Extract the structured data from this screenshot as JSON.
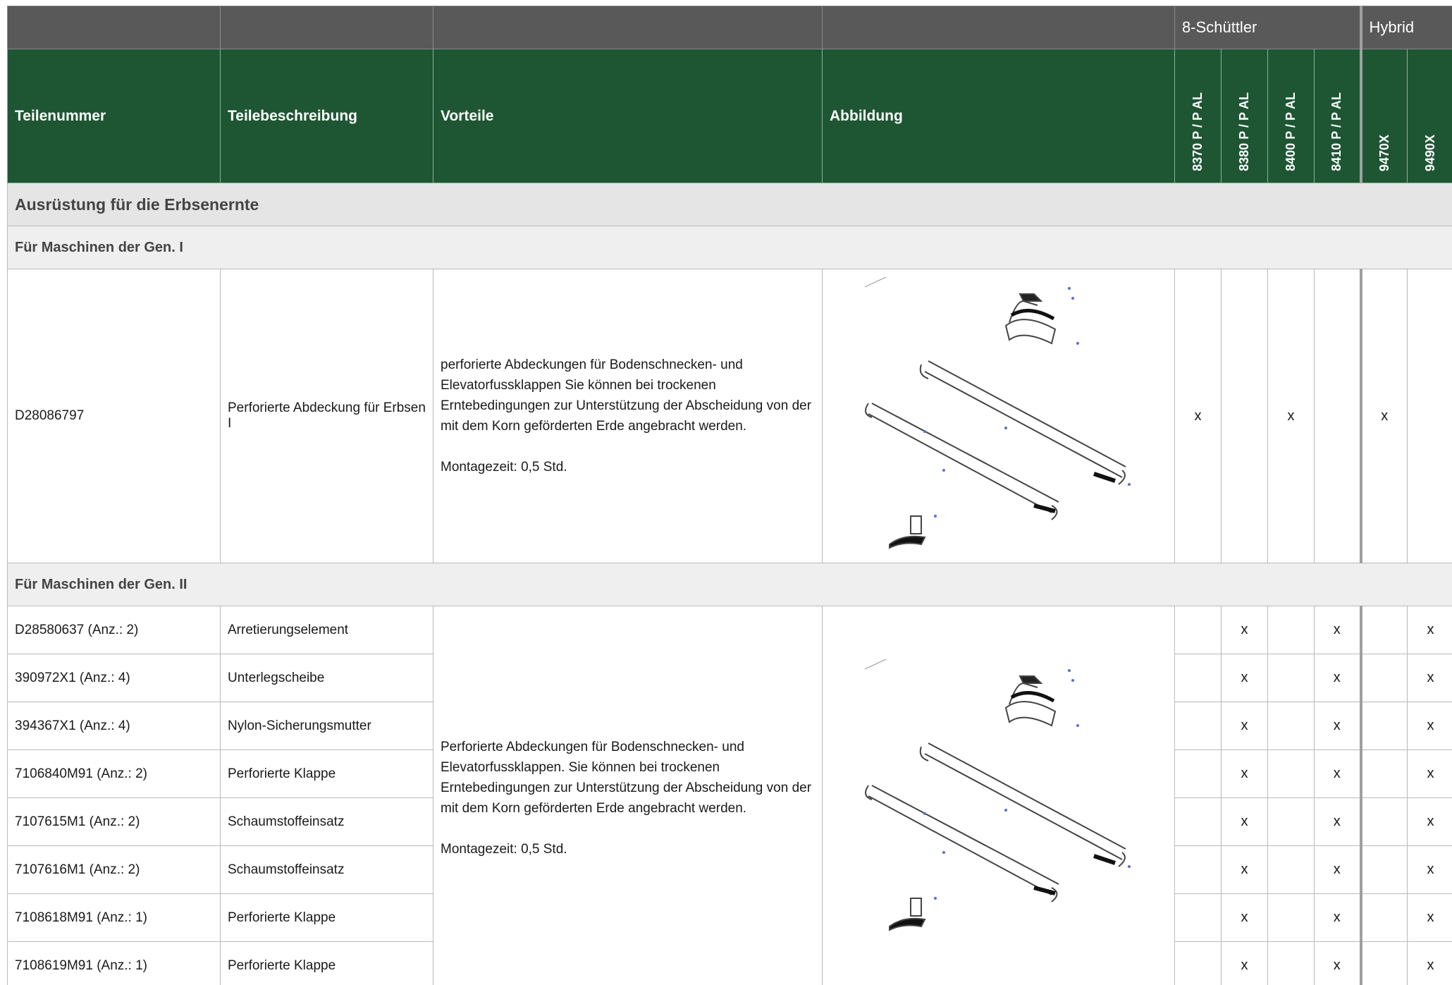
{
  "groups": {
    "schuettler": "8-Schüttler",
    "hybrid": "Hybrid"
  },
  "headers": {
    "teilenummer": "Teilenummer",
    "teilebeschreibung": "Teilebeschreibung",
    "vorteile": "Vorteile",
    "abbildung": "Abbildung",
    "models": [
      "8370 P / P AL",
      "8380 P / P AL",
      "8400 P / P AL",
      "8410 P / P AL",
      "9470X",
      "9490X"
    ]
  },
  "section_title": "Ausrüstung für die Erbsenernte",
  "gen1": {
    "title": "Für Maschinen der Gen. I",
    "part": "D28086797",
    "description": "Perforierte Abdeckung für Erbsen I",
    "vorteile": "perforierte Abdeckungen für Bodenschnecken- und Elevatorfussklappen Sie können bei trockenen Erntebedingungen zur Unterstützung der Abscheidung von der mit dem Korn geförderten Erde angebracht werden.",
    "montage": "Montagezeit: 0,5 Std.",
    "marks": [
      "x",
      "",
      "x",
      "",
      "x",
      ""
    ]
  },
  "gen2": {
    "title": "Für Maschinen der Gen. II",
    "vorteile": "Perforierte Abdeckungen für Bodenschnecken- und Elevatorfussklappen. Sie können bei trockenen Erntebedingungen zur Unterstützung der Abscheidung von der mit dem Korn geförderten Erde angebracht werden.",
    "montage": "Montagezeit: 0,5 Std.",
    "rows": [
      {
        "part": "D28580637 (Anz.: 2)",
        "description": "Arretierungselement",
        "marks": [
          "",
          "x",
          "",
          "x",
          "",
          "x"
        ]
      },
      {
        "part": "390972X1 (Anz.: 4)",
        "description": "Unterlegscheibe",
        "marks": [
          "",
          "x",
          "",
          "x",
          "",
          "x"
        ]
      },
      {
        "part": "394367X1 (Anz.: 4)",
        "description": "Nylon-Sicherungsmutter",
        "marks": [
          "",
          "x",
          "",
          "x",
          "",
          "x"
        ]
      },
      {
        "part": "7106840M91 (Anz.: 2)",
        "description": "Perforierte Klappe",
        "marks": [
          "",
          "x",
          "",
          "x",
          "",
          "x"
        ]
      },
      {
        "part": "7107615M1 (Anz.: 2)",
        "description": "Schaumstoffeinsatz",
        "marks": [
          "",
          "x",
          "",
          "x",
          "",
          "x"
        ]
      },
      {
        "part": "7107616M1 (Anz.: 2)",
        "description": "Schaumstoffeinsatz",
        "marks": [
          "",
          "x",
          "",
          "x",
          "",
          "x"
        ]
      },
      {
        "part": "7108618M91 (Anz.: 1)",
        "description": "Perforierte Klappe",
        "marks": [
          "",
          "x",
          "",
          "x",
          "",
          "x"
        ]
      },
      {
        "part": "7108619M91 (Anz.: 1)",
        "description": "Perforierte Klappe",
        "marks": [
          "",
          "x",
          "",
          "x",
          "",
          "x"
        ]
      }
    ]
  }
}
